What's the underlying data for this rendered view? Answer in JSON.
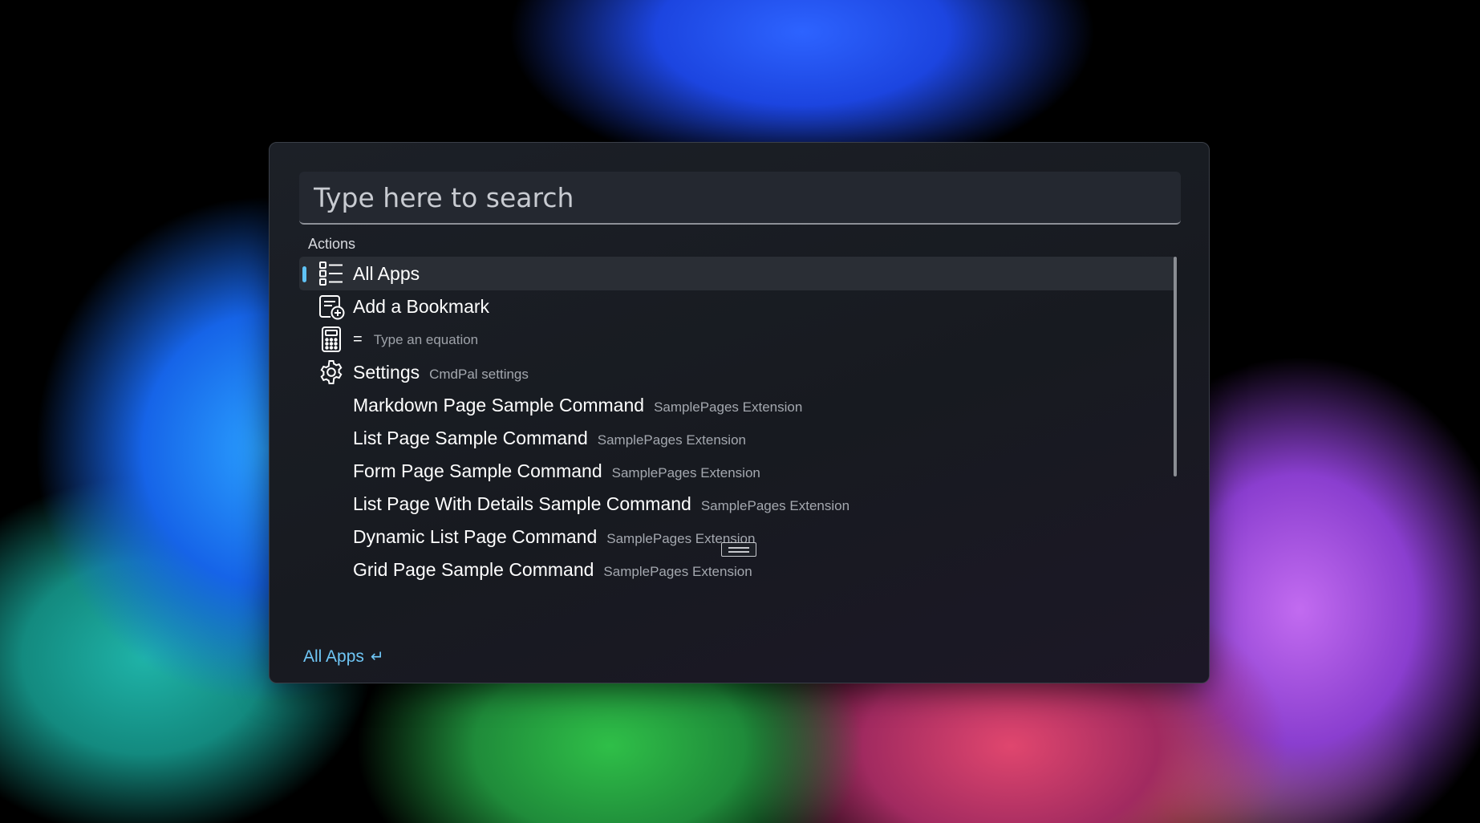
{
  "search": {
    "placeholder": "Type here to search"
  },
  "section_title": "Actions",
  "items": [
    {
      "title": "All Apps",
      "subtitle": "",
      "icon": "list-icon",
      "selected": true
    },
    {
      "title": "Add a Bookmark",
      "subtitle": "",
      "icon": "bookmark-add-icon"
    },
    {
      "title": "=",
      "subtitle": "Type an equation",
      "icon": "calculator-icon"
    },
    {
      "title": "Settings",
      "subtitle": "CmdPal settings",
      "icon": "gear-icon"
    },
    {
      "title": "Markdown Page Sample Command",
      "subtitle": "SamplePages Extension"
    },
    {
      "title": "List Page Sample Command",
      "subtitle": "SamplePages Extension"
    },
    {
      "title": "Form Page Sample Command",
      "subtitle": "SamplePages Extension"
    },
    {
      "title": "List Page With Details Sample Command",
      "subtitle": "SamplePages Extension"
    },
    {
      "title": "Dynamic List Page Command",
      "subtitle": "SamplePages Extension"
    },
    {
      "title": "Grid Page Sample Command",
      "subtitle": "SamplePages Extension"
    }
  ],
  "footer": {
    "primary_action": "All Apps",
    "enter_glyph": "↵"
  },
  "colors": {
    "accent": "#5fc2f5",
    "link": "#6fc6f5"
  }
}
